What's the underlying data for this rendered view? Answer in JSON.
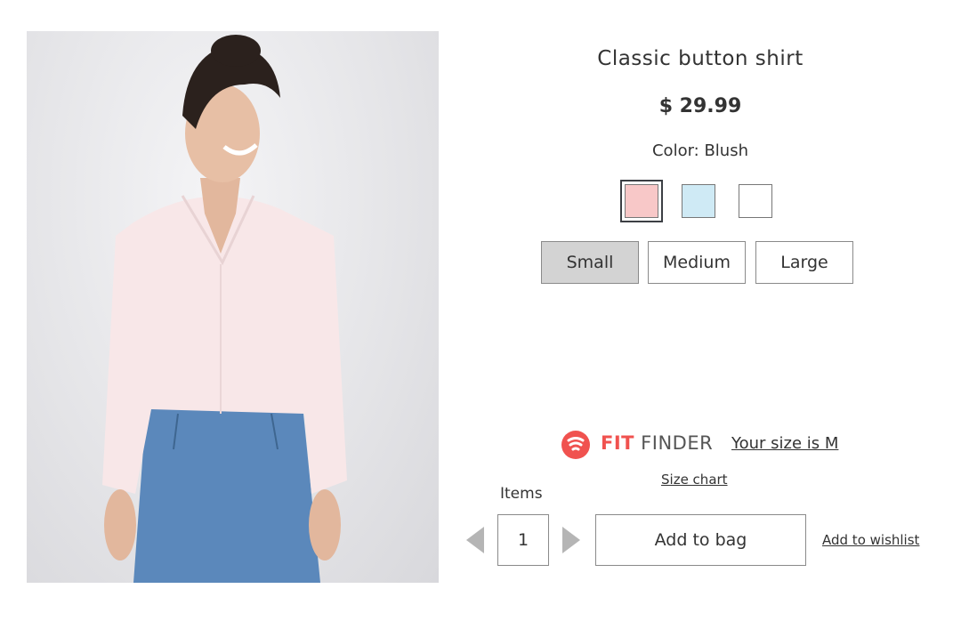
{
  "product": {
    "title": "Classic button shirt",
    "price": "$ 29.99",
    "color_label": "Color: Blush"
  },
  "colors": [
    {
      "name": "blush",
      "hex": "#f8c8c8",
      "selected": true
    },
    {
      "name": "light-blue",
      "hex": "#cfeaf5",
      "selected": false
    },
    {
      "name": "white",
      "hex": "#ffffff",
      "selected": false
    }
  ],
  "sizes": [
    {
      "label": "Small",
      "active": true
    },
    {
      "label": "Medium",
      "active": false
    },
    {
      "label": "Large",
      "active": false
    }
  ],
  "fit_finder": {
    "fit": "FIT",
    "finder": "FINDER",
    "recommendation": "Your size is M",
    "brand_color": "#f0524f"
  },
  "size_chart_label": "Size chart",
  "cart": {
    "items_label": "Items",
    "quantity": "1",
    "add_to_bag": "Add to bag",
    "add_to_wishlist": "Add to wishlist"
  }
}
